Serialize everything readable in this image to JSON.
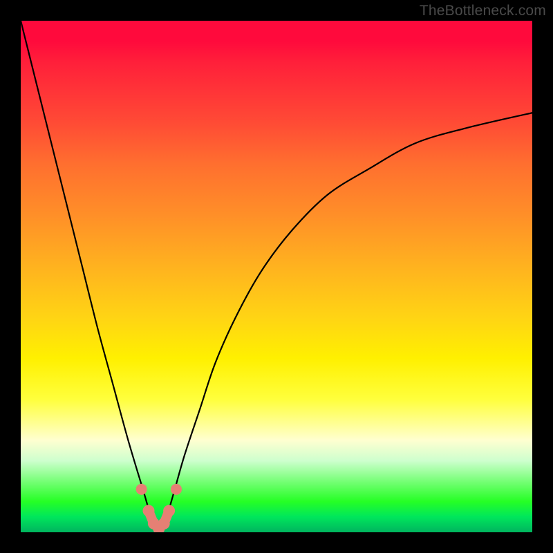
{
  "watermark": "TheBottleneck.com",
  "colors": {
    "page_bg": "#000000",
    "curve_stroke": "#000000",
    "marker_fill": "#e58074",
    "gradient_top": "#ff0a3c",
    "gradient_mid": "#ffff3c",
    "gradient_bottom": "#00b45e"
  },
  "chart_data": {
    "type": "line",
    "title": "",
    "xlabel": "",
    "ylabel": "",
    "xlim": [
      0,
      100
    ],
    "ylim": [
      0,
      100
    ],
    "grid": false,
    "legend": false,
    "series": [
      {
        "name": "bottleneck-curve",
        "x": [
          0,
          3,
          6,
          9,
          12,
          15,
          18,
          21,
          24,
          25.5,
          27,
          28.5,
          30,
          32,
          35,
          38,
          42,
          47,
          53,
          60,
          68,
          77,
          87,
          100
        ],
        "values": [
          100,
          88,
          76,
          64,
          52,
          40,
          29,
          18,
          8,
          3,
          0,
          3,
          8,
          15,
          24,
          33,
          42,
          51,
          59,
          66,
          71,
          76,
          79,
          82
        ],
        "note": "x/y in 0–100 viewport units; y=0 at bottom, minimum near x≈27"
      }
    ],
    "markers": {
      "name": "highlighted-points",
      "color": "#e58074",
      "x": [
        23.6,
        25.0,
        26.0,
        27.0,
        28.0,
        29.0,
        30.4
      ],
      "values": [
        8.4,
        4.2,
        1.7,
        0.7,
        1.7,
        4.2,
        8.4
      ]
    }
  }
}
